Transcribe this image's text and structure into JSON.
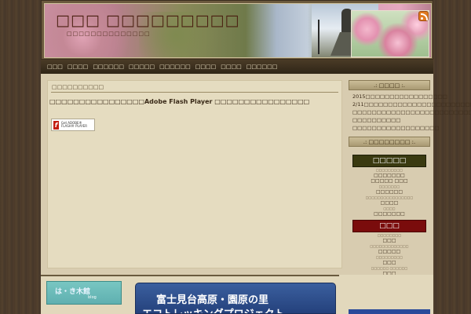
{
  "header": {
    "site_title": "□□□ □□□□□□□□□",
    "site_description": "□□□□□□□□□□□□□□"
  },
  "nav": {
    "items": [
      "□□□",
      "□□□□",
      "□□□□□□",
      "□□□□□",
      "□□□□□□",
      "□□□□",
      "□□□□",
      "□□□□□□"
    ]
  },
  "main": {
    "breadcrumb": "□□□□□□□□□□",
    "notice": "□□□□□□□□□□□□□□□□Adobe Flash Player □□□□□□□□□□□□□□□□",
    "flash_badge_text": "Get ADOBE® FLASH® PLAYER"
  },
  "bottom": {
    "haiki_title": "は・き木館",
    "haiki_sub": "blog",
    "fuji_line1": "富士見台高原・園原の里",
    "fuji_line2": "エコトレッキングプロジェクト"
  },
  "sidebar": {
    "news_title": ".: □□□□ :.",
    "news_items": [
      "2015□□□□□□□□□□□□□□□□□",
      "2/11□□□□□□□□□□□□□□□□□□□□□□□□□",
      "□□□□□□□□□□□□□□□□□□□□□□□□□",
      "□□□□□□□□□□",
      "□□□□□□□□□□□□□□□□□□"
    ],
    "categories_title": ".: □□□□□□□□ :.",
    "cat1_title": "□□□□□",
    "cat1_items": [
      {
        "label": "□□□□□□□□□",
        "small": true
      },
      {
        "label": "□□□□□□□",
        "small": false
      },
      {
        "label": "□□□□□ □□□",
        "small": false
      },
      {
        "label": "□□□□□□□",
        "small": true
      },
      {
        "label": "□□□□□□",
        "small": false
      },
      {
        "label": "□□□□□□□□□□□□□□□□",
        "small": true
      },
      {
        "label": "□□□□",
        "small": false
      },
      {
        "label": "□□□□",
        "small": true
      },
      {
        "label": "□□□□□□□",
        "small": false
      }
    ],
    "cat2_title": "□□□",
    "cat2_items": [
      {
        "label": "□□□□□□□□",
        "small": true
      },
      {
        "label": "□□□",
        "small": false
      },
      {
        "label": "□□□□□□□□□□□□□",
        "small": true
      },
      {
        "label": "□□□□□",
        "small": false
      },
      {
        "label": "□□□□□□□□□",
        "small": true
      },
      {
        "label": "□□□",
        "small": false
      },
      {
        "label": "□□□□□□ □□□□□□",
        "small": true
      },
      {
        "label": "□□□",
        "small": false
      },
      {
        "label": "□□□□□□ □□",
        "small": false
      },
      {
        "label": "□□□□ □□□□",
        "small": false
      }
    ]
  },
  "colors": {
    "background": "#4a3a2a",
    "nav": "#2f2517",
    "category_green": "#3a3a10",
    "category_red": "#7a0c0c"
  }
}
